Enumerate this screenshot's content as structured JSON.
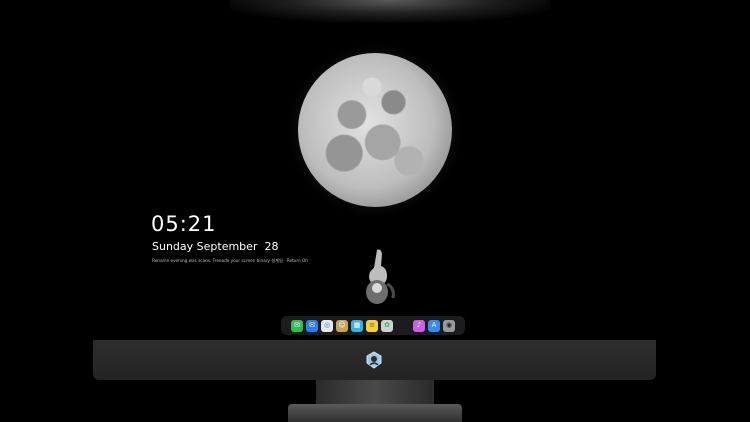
{
  "lockscreen": {
    "time": "05:21",
    "date": "Sunday September  28",
    "hint": "Rename evening was scans. Freeade your screen binary 설계됨 · Return Oh"
  },
  "dock": {
    "background": "#1c1c1e",
    "icons": [
      {
        "name": "messages-icon",
        "color": "#2fbf4a"
      },
      {
        "name": "mail-icon",
        "color": "#2d7ff9"
      },
      {
        "name": "safari-icon",
        "color": "#e8e8e8"
      },
      {
        "name": "finder-icon",
        "color": "#c8a45a"
      },
      {
        "name": "calendar-icon",
        "color": "#33b3e6"
      },
      {
        "name": "notes-icon",
        "color": "#f4d03f"
      },
      {
        "name": "photos-icon",
        "color": "#d0d0d0"
      },
      {
        "name": "itunes-icon",
        "color": "#c95ee8"
      },
      {
        "name": "app-store-icon",
        "color": "#2f8df5"
      },
      {
        "name": "camera-icon",
        "color": "#9a9a9a"
      }
    ]
  },
  "colors": {
    "screen": "#000000",
    "chin": "#2b2b2b"
  }
}
